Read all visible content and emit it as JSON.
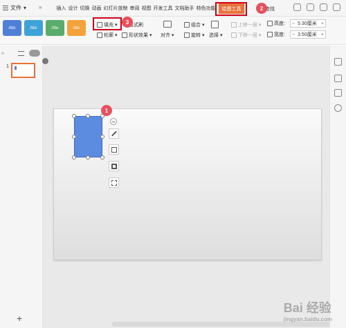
{
  "menubar": {
    "file_label": "文件",
    "tabs": [
      "插入",
      "设计",
      "切换",
      "动画",
      "幻灯片放映",
      "审阅",
      "视图",
      "开发工具",
      "文档助手",
      "特色功能"
    ],
    "drawing_tab": "绘图工具",
    "search_label": "查找"
  },
  "ribbon": {
    "styles": [
      "Abc",
      "Abc",
      "Abc",
      "Abc"
    ],
    "fill_label": "填充",
    "format_brush_label": "格式刷",
    "outline_label": "轮廓",
    "shape_effect_label": "形状效果",
    "group_label": "组合",
    "align_label": "对齐",
    "rotate_label": "旋转",
    "select_label": "选择",
    "up_layer_label": "上移一层",
    "down_layer_label": "下移一层",
    "height_label": "高度:",
    "height_value": "5.30厘米",
    "width_label": "宽度:",
    "width_value": "3.50厘米"
  },
  "thumbs": {
    "slide_number": "1"
  },
  "badges": [
    "1",
    "2",
    "3"
  ],
  "watermark": {
    "main": "Bai 经验",
    "sub": "jingyan.baidu.com"
  },
  "colors": {
    "accent": "#e8723a",
    "highlight": "#d0021b",
    "shape": "#5b8ce0"
  }
}
